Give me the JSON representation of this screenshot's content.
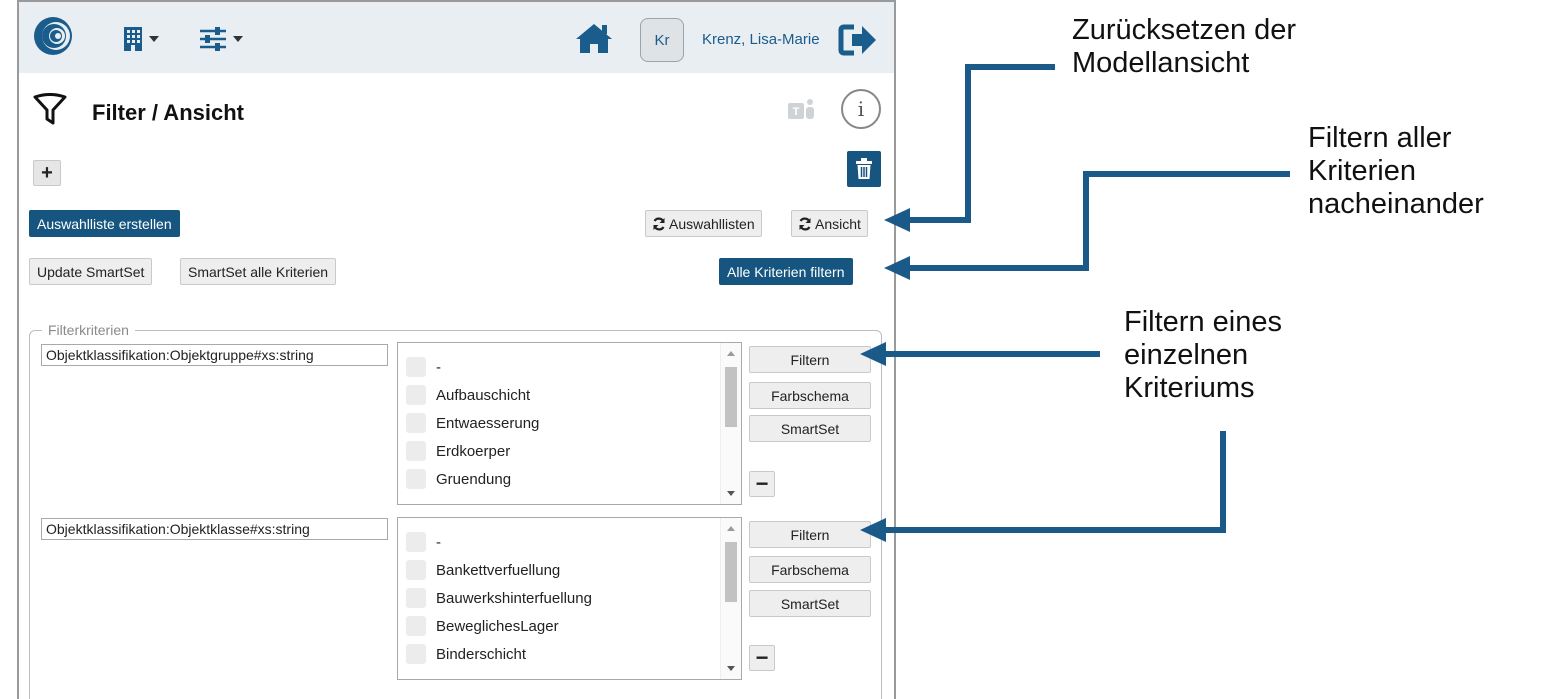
{
  "header": {
    "user_initials": "Kr",
    "user_name": "Krenz, Lisa-Marie"
  },
  "panel": {
    "title": "Filter / Ansicht",
    "info_glyph": "i"
  },
  "toolbar": {
    "add_label": "+",
    "create_list_label": "Auswahlliste erstellen",
    "reset_lists_label": "Auswahllisten",
    "reset_view_label": "Ansicht",
    "update_smartset_label": "Update SmartSet",
    "smartset_all_label": "SmartSet alle Kriterien",
    "filter_all_label": "Alle Kriterien filtern"
  },
  "criteria": {
    "legend": "Filterkriterien",
    "items": [
      {
        "property": "Objektklassifikation:Objektgruppe#xs:string",
        "options": [
          "-",
          "Aufbauschicht",
          "Entwaesserung",
          "Erdkoerper",
          "Gruendung"
        ],
        "filter_label": "Filtern",
        "color_label": "Farbschema",
        "smartset_label": "SmartSet",
        "remove_label": "−"
      },
      {
        "property": "Objektklassifikation:Objektklasse#xs:string",
        "options": [
          "-",
          "Bankettverfuellung",
          "Bauwerkshinterfuellung",
          "BeweglichesLager",
          "Binderschicht"
        ],
        "filter_label": "Filtern",
        "color_label": "Farbschema",
        "smartset_label": "SmartSet",
        "remove_label": "−"
      }
    ]
  },
  "annotations": {
    "reset_1": "Zurücksetzen der",
    "reset_2": "Modellansicht",
    "all_1": "Filtern aller",
    "all_2": "Kriterien",
    "all_3": "nacheinander",
    "single_1": "Filtern eines",
    "single_2": "einzelnen",
    "single_3": "Kriteriums"
  },
  "colors": {
    "primary": "#16557f",
    "arrow": "#1b5a88",
    "topbar": "#e9eef2"
  },
  "icons": {
    "logo": "app-logo-icon",
    "building": "building-icon",
    "settings": "sliders-icon",
    "home": "home-icon",
    "logout": "logout-icon",
    "filter": "funnel-icon",
    "teams": "teams-icon",
    "info": "info-icon",
    "trash": "trash-icon",
    "refresh": "refresh-icon"
  }
}
